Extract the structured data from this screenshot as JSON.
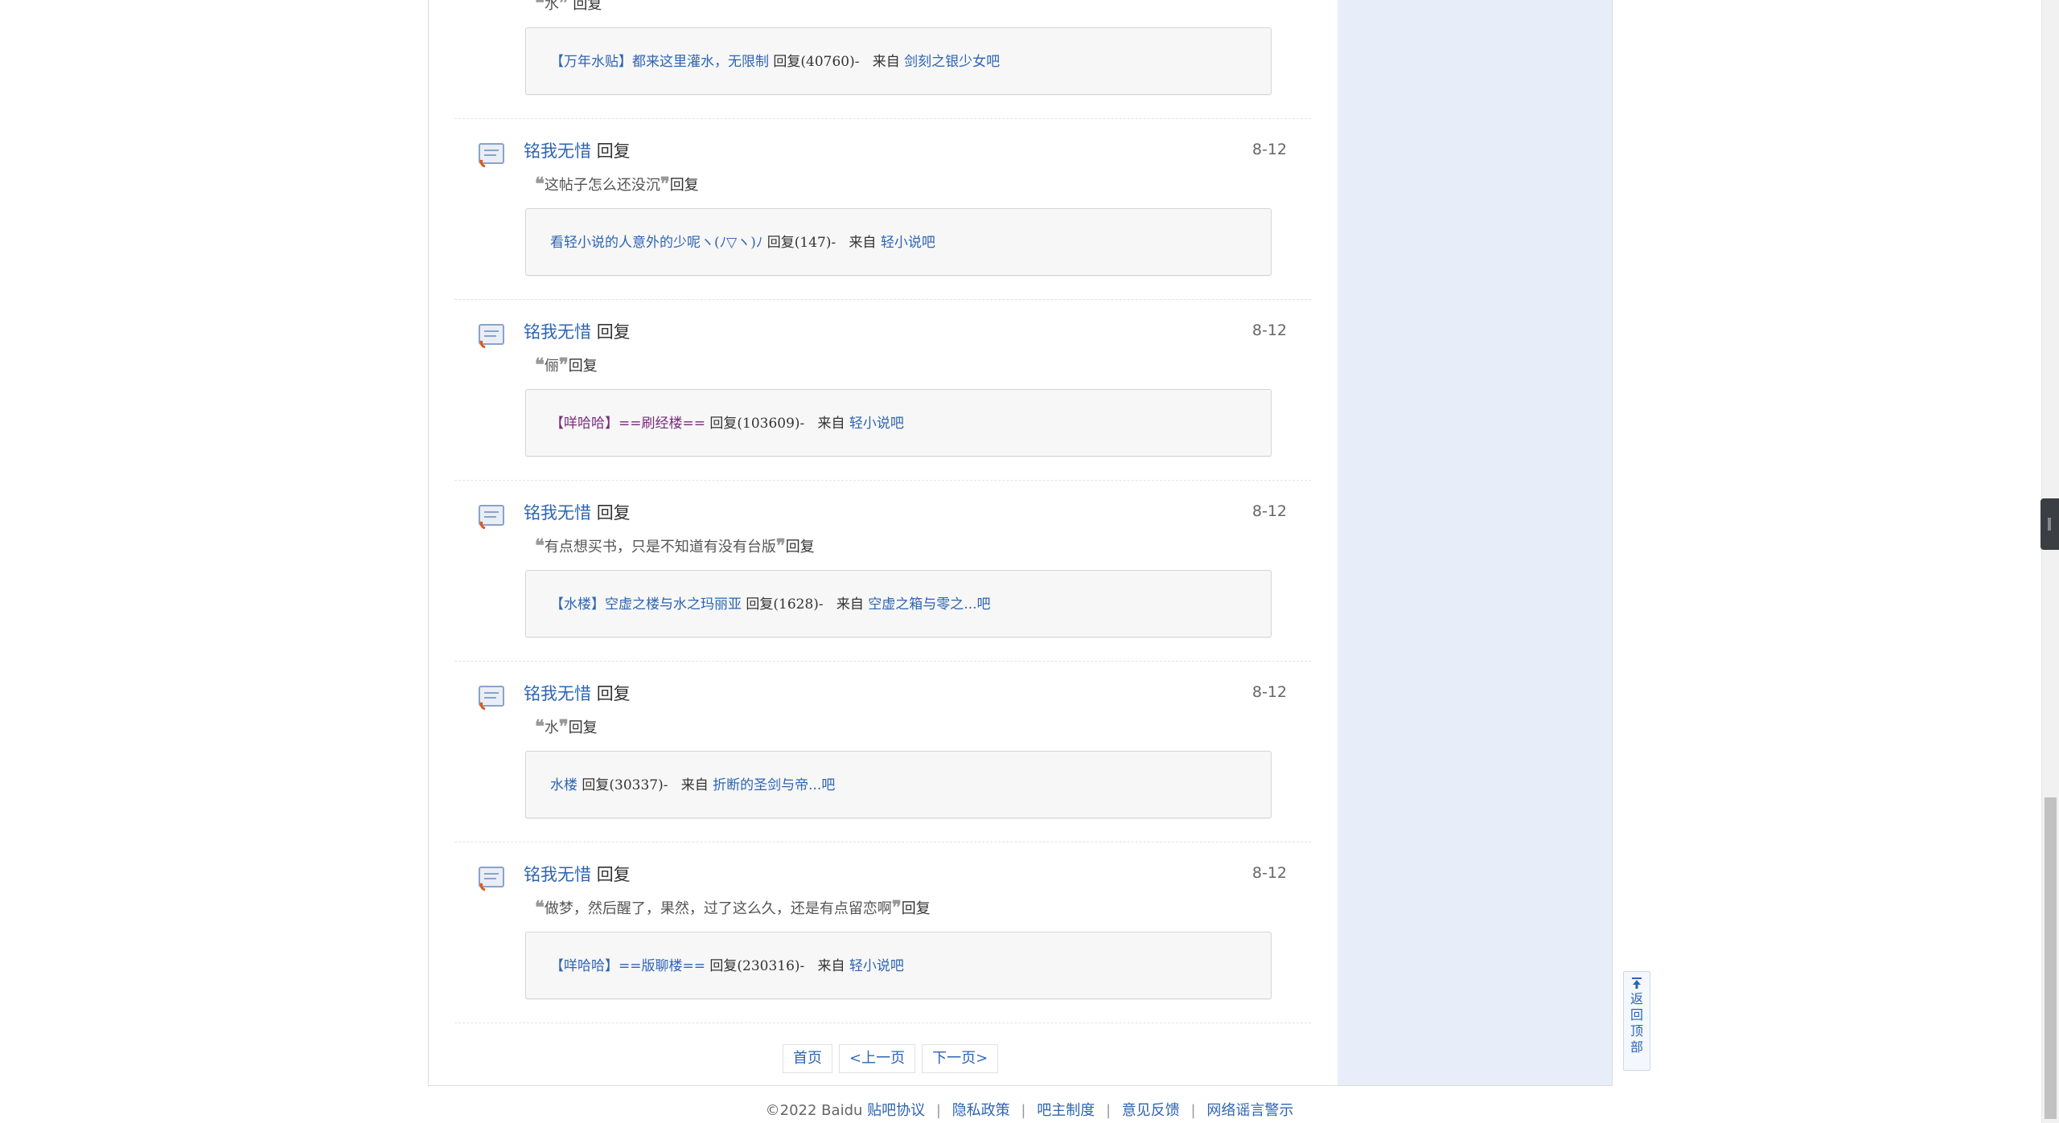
{
  "feed": {
    "items": [
      {
        "user": "",
        "action": "",
        "date": "",
        "quote": "水",
        "reply_suffix": "回复",
        "source": {
          "tag": "【万年水贴】",
          "thread": "都来这里灌水，无限制",
          "reply_count": "回复(40760)-",
          "from_label": "来自",
          "forum": "剑刻之银少女吧"
        }
      },
      {
        "user": "铭我无惜",
        "action": "回复",
        "date": "8-12",
        "quote": "这帖子怎么还没沉",
        "reply_suffix": "回复",
        "source": {
          "tag": "",
          "thread": "看轻小说的人意外的少呢ヽ(ﾉ▽ヽ)ﾉ",
          "reply_count": "回复(147)-",
          "from_label": "来自",
          "forum": "轻小说吧"
        }
      },
      {
        "user": "铭我无惜",
        "action": "回复",
        "date": "8-12",
        "quote": "俪",
        "reply_suffix": "回复",
        "source": {
          "tag": "【咩哈哈】",
          "thread": "==刷经楼==",
          "reply_count": "回复(103609)-",
          "from_label": "来自",
          "forum": "轻小说吧"
        }
      },
      {
        "user": "铭我无惜",
        "action": "回复",
        "date": "8-12",
        "quote": "有点想买书，只是不知道有没有台版",
        "reply_suffix": "回复",
        "source": {
          "tag": "【水楼】",
          "thread": "空虚之楼与水之玛丽亚",
          "reply_count": "回复(1628)-",
          "from_label": "来自",
          "forum": "空虚之箱与零之...吧"
        }
      },
      {
        "user": "铭我无惜",
        "action": "回复",
        "date": "8-12",
        "quote": "水",
        "reply_suffix": "回复",
        "source": {
          "tag": "",
          "thread": "水楼",
          "reply_count": "回复(30337)-",
          "from_label": "来自",
          "forum": "折断的圣剑与帝...吧"
        }
      },
      {
        "user": "铭我无惜",
        "action": "回复",
        "date": "8-12",
        "quote": "做梦，然后醒了，果然，过了这么久，还是有点留恋啊",
        "reply_suffix": "回复",
        "source": {
          "tag": "【咩哈哈】",
          "thread": "==版聊楼==",
          "reply_count": "回复(230316)-",
          "from_label": "来自",
          "forum": "轻小说吧"
        }
      }
    ]
  },
  "pager": {
    "first": "首页",
    "prev": "<上一页",
    "next": "下一页>"
  },
  "footer": {
    "copyright": "©2022 Baidu",
    "links": [
      "贴吧协议",
      "隐私政策",
      "吧主制度",
      "意见反馈",
      "网络谣言警示"
    ],
    "separator": "|"
  },
  "back_top": {
    "label": "返回顶部"
  },
  "colors": {
    "link": "#2d64b3",
    "sidebar_bg": "#e8eef9",
    "purple_tag": "#7a2a7a"
  }
}
